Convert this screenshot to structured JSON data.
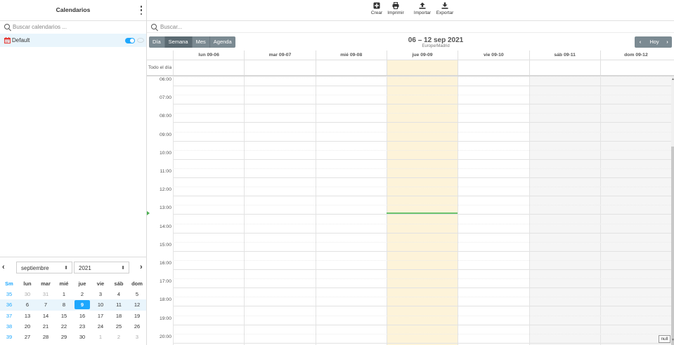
{
  "left": {
    "title": "Calendarios",
    "search_placeholder": "Buscar calendarios ...",
    "calendar": {
      "name": "Default",
      "enabled": true,
      "color": "#e53935"
    },
    "mini": {
      "prev_icon": "chevron-left-icon",
      "next_icon": "chevron-right-icon",
      "month": "septiembre",
      "year": "2021",
      "headers": [
        "Sm",
        "lun",
        "mar",
        "mié",
        "jue",
        "vie",
        "sáb",
        "dom"
      ],
      "weeks": [
        {
          "wk": "35",
          "days": [
            "30",
            "31",
            "1",
            "2",
            "3",
            "4",
            "5"
          ]
        },
        {
          "wk": "36",
          "days": [
            "6",
            "7",
            "8",
            "9",
            "10",
            "11",
            "12"
          ]
        },
        {
          "wk": "37",
          "days": [
            "13",
            "14",
            "15",
            "16",
            "17",
            "18",
            "19"
          ]
        },
        {
          "wk": "38",
          "days": [
            "20",
            "21",
            "22",
            "23",
            "24",
            "25",
            "26"
          ]
        },
        {
          "wk": "39",
          "days": [
            "27",
            "28",
            "29",
            "30",
            "1",
            "2",
            "3"
          ]
        }
      ]
    }
  },
  "toolbar": {
    "crear": "Crear",
    "imprimir": "Imprimir",
    "importar": "Importar",
    "exportar": "Exportar"
  },
  "main": {
    "search_placeholder": "Buscar...",
    "views": [
      "Día",
      "Semana",
      "Mes",
      "Agenda"
    ],
    "active_view": "Semana",
    "range": "06 – 12 sep 2021",
    "timezone": "Europe/Madrid",
    "today_label": "Hoy",
    "days": [
      "lun 09-06",
      "mar 09-07",
      "mié 09-08",
      "jue 09-09",
      "vie 09-10",
      "sáb 09-11",
      "dom 09-12"
    ],
    "today_index": 3,
    "allday_label": "Todo el día",
    "hours": [
      "06:00",
      "07:00",
      "08:00",
      "09:00",
      "10:00",
      "11:00",
      "12:00",
      "13:00",
      "14:00",
      "15:00",
      "16:00",
      "17:00",
      "18:00",
      "19:00",
      "20:00"
    ],
    "null_badge": "null"
  },
  "colors": {
    "accent": "#1ea7fd",
    "today_bg": "#fdf3d9",
    "weekend_bg": "#f5f5f5",
    "now_line": "#6dc36d",
    "button_bg": "#7b8a92"
  }
}
